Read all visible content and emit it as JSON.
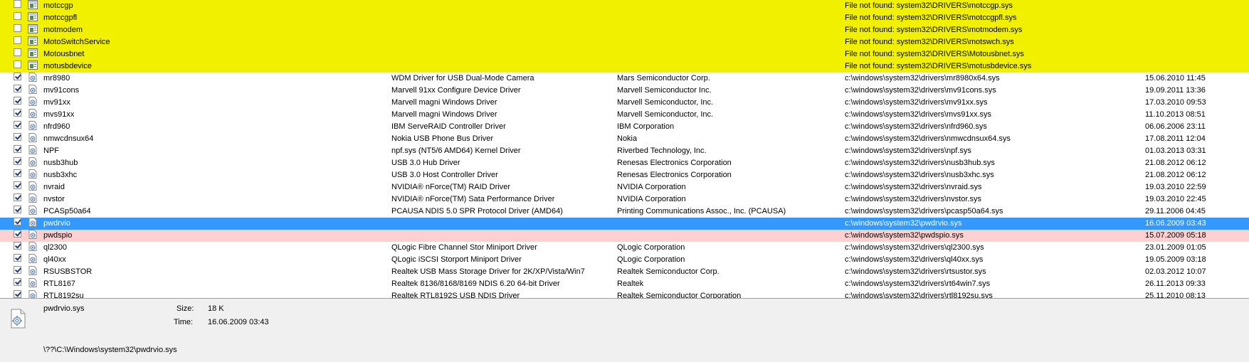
{
  "rows": [
    {
      "checked": false,
      "state": "missing",
      "icon": "driver-missing-icon",
      "name": "motccgp",
      "description": "",
      "company": "",
      "path": "File not found: system32\\DRIVERS\\motccgp.sys",
      "time": ""
    },
    {
      "checked": false,
      "state": "missing",
      "icon": "driver-missing-icon",
      "name": "motccgpfl",
      "description": "",
      "company": "",
      "path": "File not found: system32\\DRIVERS\\motccgpfl.sys",
      "time": ""
    },
    {
      "checked": false,
      "state": "missing",
      "icon": "driver-missing-icon",
      "name": "motmodem",
      "description": "",
      "company": "",
      "path": "File not found: system32\\DRIVERS\\motmodem.sys",
      "time": ""
    },
    {
      "checked": false,
      "state": "missing",
      "icon": "driver-missing-icon",
      "name": "MotoSwitchService",
      "description": "",
      "company": "",
      "path": "File not found: system32\\DRIVERS\\motswch.sys",
      "time": ""
    },
    {
      "checked": false,
      "state": "missing",
      "icon": "driver-missing-icon",
      "name": "Motousbnet",
      "description": "",
      "company": "",
      "path": "File not found: system32\\DRIVERS\\Motousbnet.sys",
      "time": ""
    },
    {
      "checked": false,
      "state": "missing",
      "icon": "driver-missing-icon",
      "name": "motusbdevice",
      "description": "",
      "company": "",
      "path": "File not found: system32\\DRIVERS\\motusbdevice.sys",
      "time": ""
    },
    {
      "checked": true,
      "state": "normal",
      "icon": "driver-file-icon",
      "name": "mr8980",
      "description": "WDM Driver for USB Dual-Mode Camera",
      "company": "Mars Semiconductor Corp.",
      "path": "c:\\windows\\system32\\drivers\\mr8980x64.sys",
      "time": "15.06.2010 11:45"
    },
    {
      "checked": true,
      "state": "normal",
      "icon": "driver-file-icon",
      "name": "mv91cons",
      "description": "Marvell 91xx Configure Device Driver",
      "company": "Marvell Semiconductor Inc.",
      "path": "c:\\windows\\system32\\drivers\\mv91cons.sys",
      "time": "19.09.2011 13:36"
    },
    {
      "checked": true,
      "state": "normal",
      "icon": "driver-file-icon",
      "name": "mv91xx",
      "description": "Marvell magni Windows Driver",
      "company": "Marvell Semiconductor, Inc.",
      "path": "c:\\windows\\system32\\drivers\\mv91xx.sys",
      "time": "17.03.2010 09:53"
    },
    {
      "checked": true,
      "state": "normal",
      "icon": "driver-file-icon",
      "name": "mvs91xx",
      "description": "Marvell magni Windows Driver",
      "company": "Marvell Semiconductor, Inc.",
      "path": "c:\\windows\\system32\\drivers\\mvs91xx.sys",
      "time": "11.10.2013 08:51"
    },
    {
      "checked": true,
      "state": "normal",
      "icon": "driver-file-icon",
      "name": "nfrd960",
      "description": "IBM ServeRAID Controller Driver",
      "company": "IBM Corporation",
      "path": "c:\\windows\\system32\\drivers\\nfrd960.sys",
      "time": "06.06.2006 23:11"
    },
    {
      "checked": true,
      "state": "normal",
      "icon": "driver-file-icon",
      "name": "nmwcdnsux64",
      "description": "Nokia USB Phone Bus Driver",
      "company": "Nokia",
      "path": "c:\\windows\\system32\\drivers\\nmwcdnsux64.sys",
      "time": "17.08.2011 12:04"
    },
    {
      "checked": true,
      "state": "normal",
      "icon": "driver-file-icon",
      "name": "NPF",
      "description": "npf.sys (NT5/6 AMD64) Kernel Driver",
      "company": "Riverbed Technology, Inc.",
      "path": "c:\\windows\\system32\\drivers\\npf.sys",
      "time": "01.03.2013 03:31"
    },
    {
      "checked": true,
      "state": "normal",
      "icon": "driver-file-icon",
      "name": "nusb3hub",
      "description": "USB 3.0 Hub Driver",
      "company": "Renesas Electronics Corporation",
      "path": "c:\\windows\\system32\\drivers\\nusb3hub.sys",
      "time": "21.08.2012 06:12"
    },
    {
      "checked": true,
      "state": "normal",
      "icon": "driver-file-icon",
      "name": "nusb3xhc",
      "description": "USB 3.0 Host Controller Driver",
      "company": "Renesas Electronics Corporation",
      "path": "c:\\windows\\system32\\drivers\\nusb3xhc.sys",
      "time": "21.08.2012 06:12"
    },
    {
      "checked": true,
      "state": "normal",
      "icon": "driver-file-icon",
      "name": "nvraid",
      "description": "NVIDIA® nForce(TM) RAID Driver",
      "company": "NVIDIA Corporation",
      "path": "c:\\windows\\system32\\drivers\\nvraid.sys",
      "time": "19.03.2010 22:59"
    },
    {
      "checked": true,
      "state": "normal",
      "icon": "driver-file-icon",
      "name": "nvstor",
      "description": "NVIDIA® nForce(TM) Sata Performance Driver",
      "company": "NVIDIA Corporation",
      "path": "c:\\windows\\system32\\drivers\\nvstor.sys",
      "time": "19.03.2010 22:45"
    },
    {
      "checked": true,
      "state": "normal",
      "icon": "driver-file-icon",
      "name": "PCASp50a64",
      "description": "PCAUSA NDIS 5.0 SPR Protocol Driver (AMD64)",
      "company": "Printing Communications Assoc., Inc. (PCAUSA)",
      "path": "c:\\windows\\system32\\drivers\\pcasp50a64.sys",
      "time": "29.11.2006 04:45"
    },
    {
      "checked": true,
      "state": "selected",
      "icon": "driver-file-icon",
      "name": "pwdrvio",
      "description": "",
      "company": "",
      "path": "c:\\windows\\system32\\pwdrvio.sys",
      "time": "16.06.2009 03:43"
    },
    {
      "checked": true,
      "state": "flagged",
      "icon": "driver-file-icon",
      "name": "pwdspio",
      "description": "",
      "company": "",
      "path": "c:\\windows\\system32\\pwdspio.sys",
      "time": "15.07.2009 05:18"
    },
    {
      "checked": true,
      "state": "normal",
      "icon": "driver-file-icon",
      "name": "ql2300",
      "description": "QLogic Fibre Channel Stor Miniport Driver",
      "company": "QLogic Corporation",
      "path": "c:\\windows\\system32\\drivers\\ql2300.sys",
      "time": "23.01.2009 01:05"
    },
    {
      "checked": true,
      "state": "normal",
      "icon": "driver-file-icon",
      "name": "ql40xx",
      "description": "QLogic iSCSI Storport Miniport Driver",
      "company": "QLogic Corporation",
      "path": "c:\\windows\\system32\\drivers\\ql40xx.sys",
      "time": "19.05.2009 03:18"
    },
    {
      "checked": true,
      "state": "normal",
      "icon": "driver-file-icon",
      "name": "RSUSBSTOR",
      "description": "Realtek USB Mass Storage Driver for 2K/XP/Vista/Win7",
      "company": "Realtek Semiconductor Corp.",
      "path": "c:\\windows\\system32\\drivers\\rtsustor.sys",
      "time": "02.03.2012 10:07"
    },
    {
      "checked": true,
      "state": "normal",
      "icon": "driver-file-icon",
      "name": "RTL8167",
      "description": "Realtek 8136/8168/8169 NDIS 6.20 64-bit Driver",
      "company": "Realtek",
      "path": "c:\\windows\\system32\\drivers\\rt64win7.sys",
      "time": "26.11.2013 09:33"
    },
    {
      "checked": true,
      "state": "normal",
      "icon": "driver-file-icon",
      "name": "RTL8192su",
      "description": "Realtek RTL8192S USB NDIS Driver",
      "company": "Realtek Semiconductor Corporation",
      "path": "c:\\windows\\system32\\drivers\\rtl8192su.sys",
      "time": "25.11.2010 08:13"
    }
  ],
  "details": {
    "icon": "system-file-icon",
    "filename": "pwdrvio.sys",
    "size_label": "Size:",
    "size_value": "18 K",
    "time_label": "Time:",
    "time_value": "16.06.2009 03:43",
    "full_path": "\\??\\C:\\Windows\\system32\\pwdrvio.sys"
  },
  "colors": {
    "missing_row": "#f0f000",
    "selected_row": "#3399ff",
    "flagged_row": "#ffd0d0"
  }
}
